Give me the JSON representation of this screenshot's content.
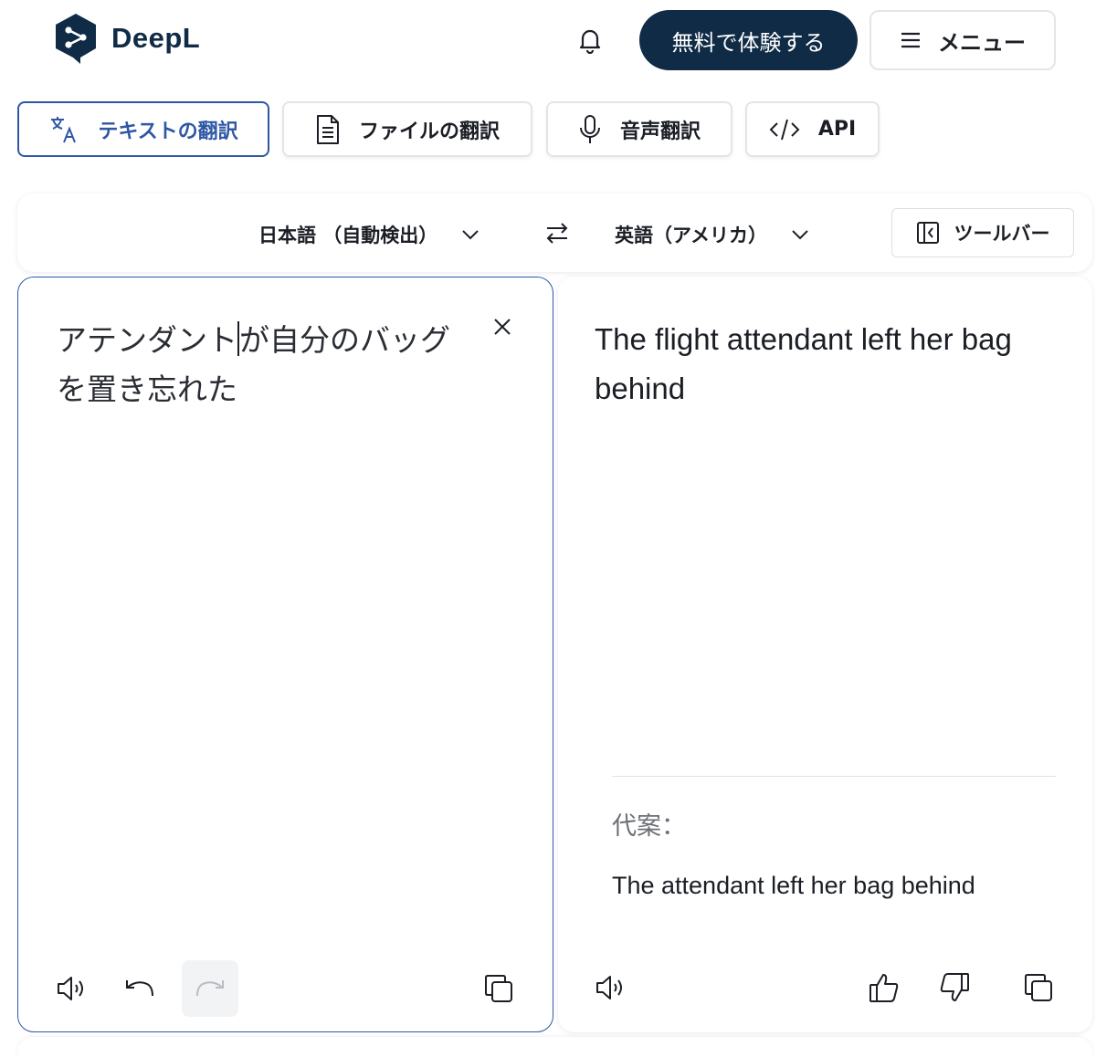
{
  "header": {
    "logo_text": "DeepL",
    "trial_button": "無料で体験する",
    "menu_label": "メニュー"
  },
  "tabs": [
    {
      "label": "テキストの翻訳",
      "icon": "translate-icon",
      "active": true
    },
    {
      "label": "ファイルの翻訳",
      "icon": "document-icon",
      "active": false
    },
    {
      "label": "音声翻訳",
      "icon": "microphone-icon",
      "active": false
    },
    {
      "label": "API",
      "icon": "code-icon",
      "active": false
    }
  ],
  "language_bar": {
    "source_language": "日本語 （自動検出）",
    "target_language": "英語（アメリカ）",
    "toolbar_label": "ツールバー"
  },
  "source": {
    "text_before_caret": "アテンダント",
    "text_after_caret": "が自分のバッグを置き忘れた"
  },
  "target": {
    "translation": "The flight attendant left her bag behind",
    "alternatives_label": "代案：",
    "alternatives": [
      "The attendant left her bag behind"
    ]
  },
  "colors": {
    "brand_navy": "#0f2b46",
    "accent_blue": "#2f57a5"
  }
}
